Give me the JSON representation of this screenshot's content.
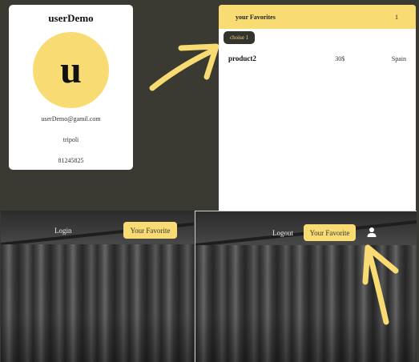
{
  "profile": {
    "name": "userDemo",
    "avatar_letter": "u",
    "email": "userDemo@gamil.com",
    "city": "tripoli",
    "phone": "81245825"
  },
  "favorites": {
    "title": "your Favorites",
    "count": "1",
    "choice_label": "choise 1",
    "items": [
      {
        "name": "product2",
        "price": "30$",
        "country": "Spain"
      }
    ]
  },
  "nav_logged_out": {
    "login_label": "Login",
    "favorite_label": "Your Favorite"
  },
  "nav_logged_in": {
    "logout_label": "Logout",
    "favorite_label": "Your Favorite",
    "user_icon": "user-icon"
  },
  "colors": {
    "accent": "#f8db72",
    "page_bg": "#3a3a33",
    "chip_bg": "#333330"
  }
}
